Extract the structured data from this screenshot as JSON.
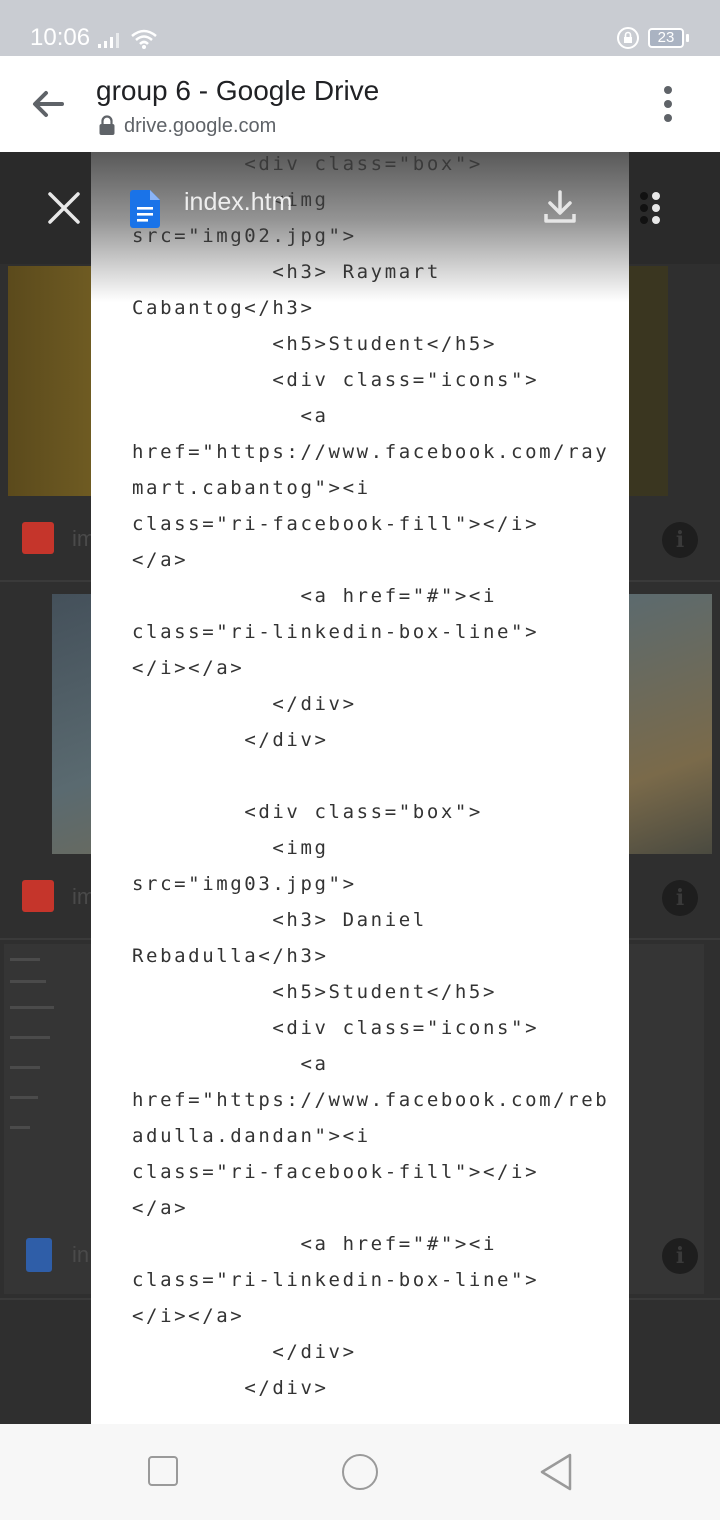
{
  "status_bar": {
    "time": "10:06",
    "battery": "23"
  },
  "header": {
    "title": "group 6 - Google Drive",
    "url": "drive.google.com"
  },
  "viewer": {
    "file_name": "index.htm"
  },
  "background_rows": [
    {
      "label": "im"
    },
    {
      "label": "im"
    },
    {
      "label": "in"
    }
  ],
  "code_content": "        <div class=\"box\">\n          <img\nsrc=\"img02.jpg\">\n          <h3> Raymart\nCabantog</h3>\n          <h5>Student</h5>\n          <div class=\"icons\">\n            <a\nhref=\"https://www.facebook.com/raymart.cabantog\"><i\nclass=\"ri-facebook-fill\"></i>\n</a>\n            <a href=\"#\"><i\nclass=\"ri-linkedin-box-line\">\n</i></a>\n          </div>\n        </div>\n\n        <div class=\"box\">\n          <img\nsrc=\"img03.jpg\">\n          <h3> Daniel\nRebadulla</h3>\n          <h5>Student</h5>\n          <div class=\"icons\">\n            <a\nhref=\"https://www.facebook.com/rebadulla.dandan\"><i\nclass=\"ri-facebook-fill\"></i>\n</a>\n            <a href=\"#\"><i\nclass=\"ri-linkedin-box-line\">\n</i></a>\n          </div>\n        </div>",
  "colors": {
    "doc_blue": "#1a73e8",
    "image_red": "#c5352b",
    "header_bg": "#ffffff",
    "status_bg": "#c9ccd2"
  },
  "icons": [
    "signal-icon",
    "wifi-icon",
    "rotation-lock-icon",
    "battery-icon",
    "back-arrow-icon",
    "lock-icon",
    "more-vert-icon",
    "close-icon",
    "docs-file-icon",
    "download-icon",
    "image-file-icon",
    "info-icon",
    "recent-apps-icon",
    "home-icon",
    "nav-back-icon"
  ]
}
